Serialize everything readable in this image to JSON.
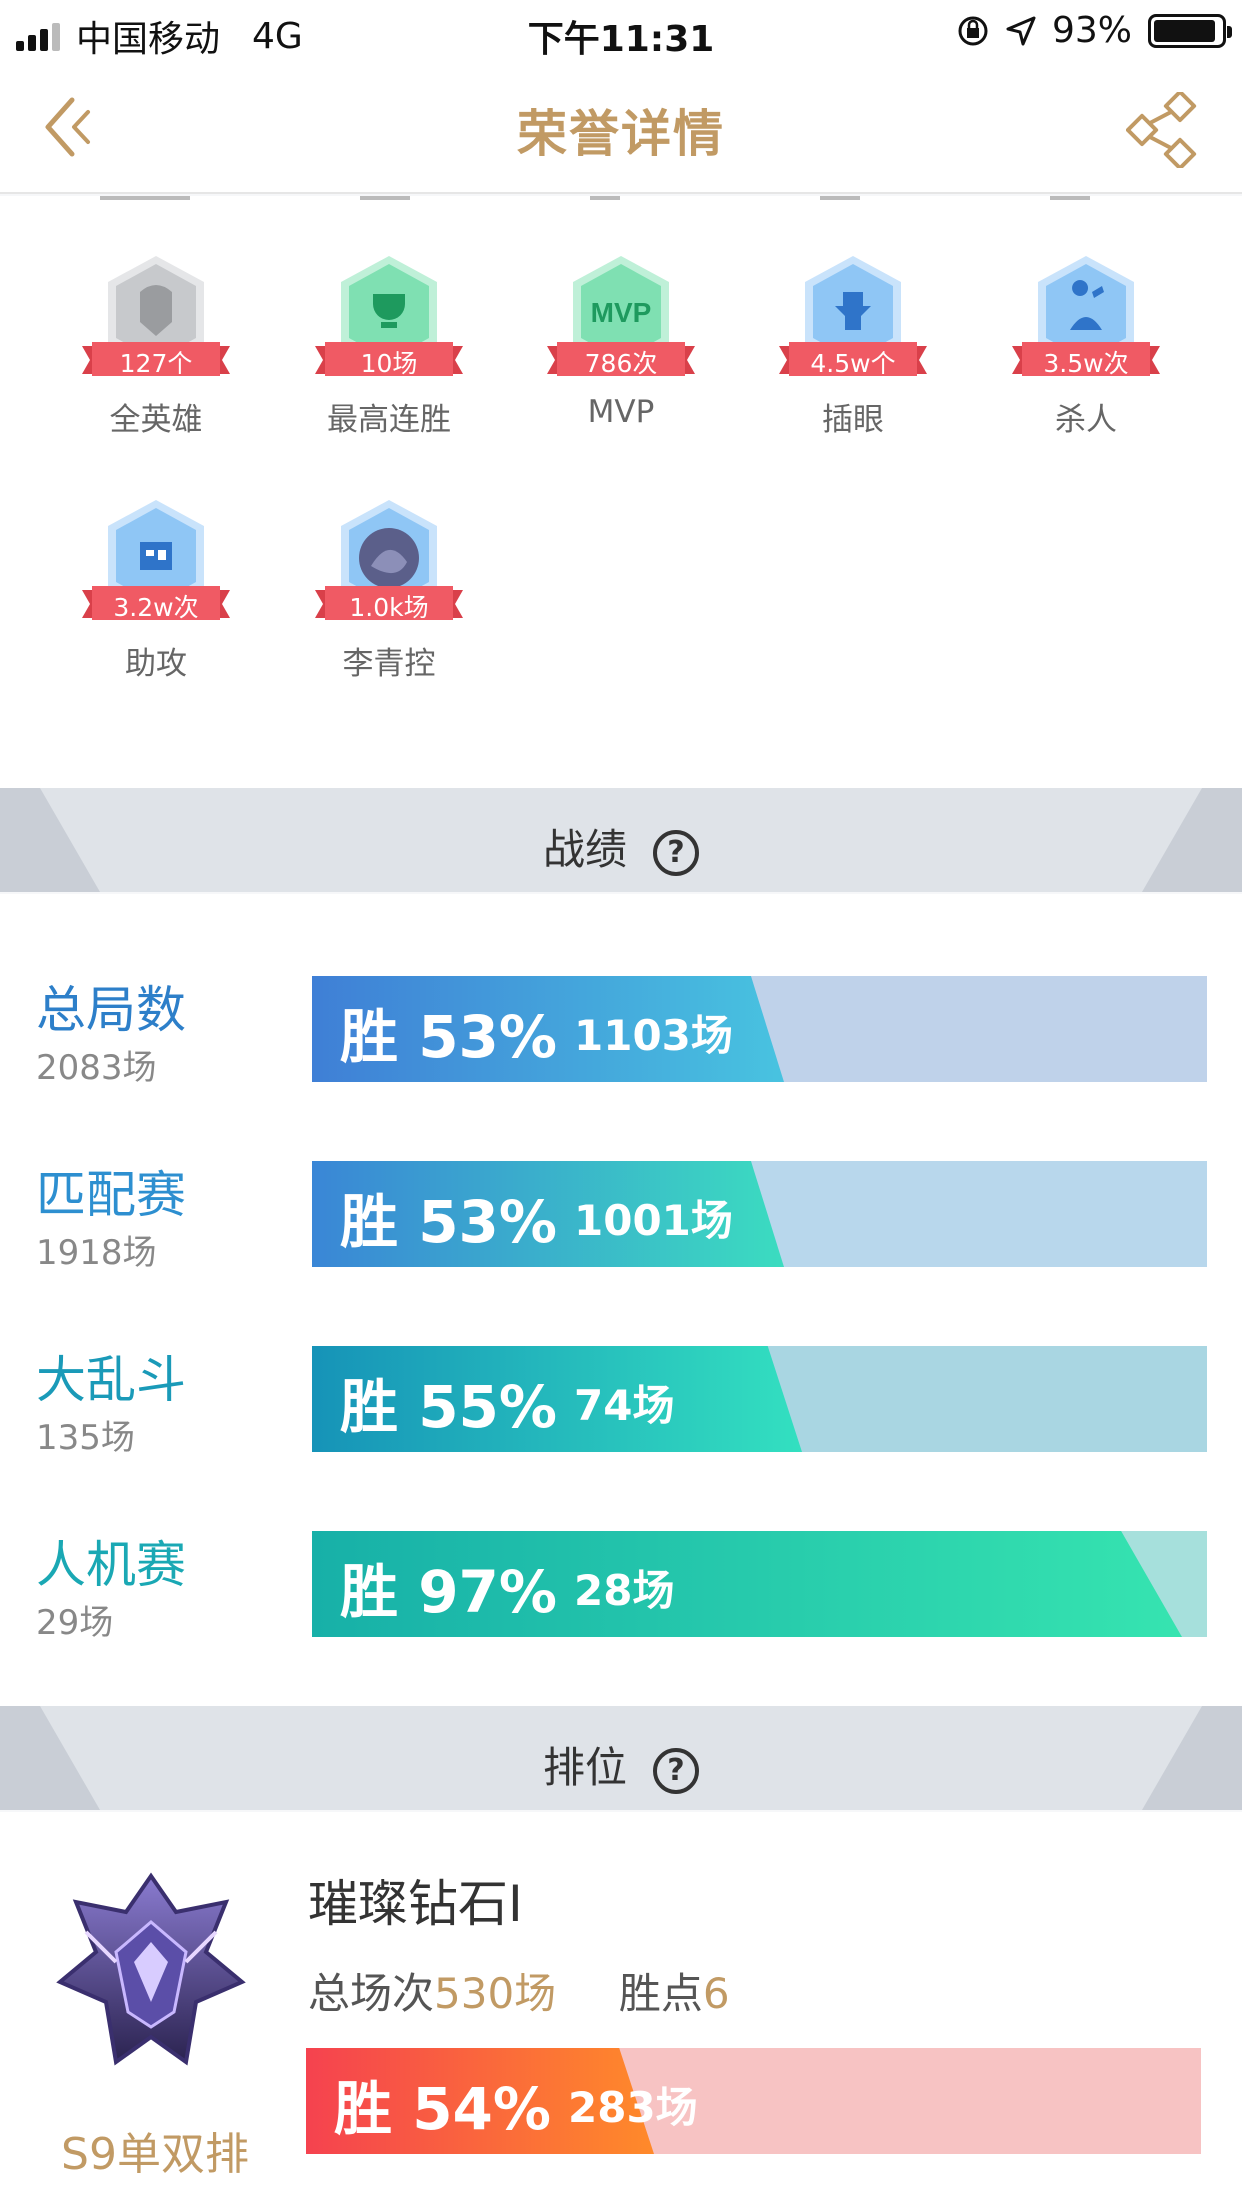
{
  "status_bar": {
    "carrier": "中国移动",
    "network": "4G",
    "time": "下午11:31",
    "battery": "93%",
    "battery_level": 0.93
  },
  "nav": {
    "title": "荣誉详情"
  },
  "honors": [
    {
      "count": "127个",
      "label": "全英雄",
      "color": "gray"
    },
    {
      "count": "10场",
      "label": "最高连胜",
      "color": "green"
    },
    {
      "count": "786次",
      "label": "MVP",
      "color": "green"
    },
    {
      "count": "4.5w个",
      "label": "插眼",
      "color": "blue"
    },
    {
      "count": "3.5w次",
      "label": "杀人",
      "color": "blue"
    },
    {
      "count": "3.2w次",
      "label": "助攻",
      "color": "blue"
    },
    {
      "count": "1.0k场",
      "label": "李青控",
      "color": "blue"
    }
  ],
  "sections": {
    "stats_title": "战绩",
    "ranked_title": "排位",
    "help_glyph": "?"
  },
  "stats": [
    {
      "name": "总局数",
      "total": "2083场",
      "win_label": "胜 53%",
      "games": "1103场",
      "win_rate": 0.53
    },
    {
      "name": "匹配赛",
      "total": "1918场",
      "win_label": "胜 53%",
      "games": "1001场",
      "win_rate": 0.53
    },
    {
      "name": "大乱斗",
      "total": "135场",
      "win_label": "胜 55%",
      "games": "74场",
      "win_rate": 0.55
    },
    {
      "name": "人机赛",
      "total": "29场",
      "win_label": "胜 97%",
      "games": "28场",
      "win_rate": 0.97
    }
  ],
  "ranked": {
    "tier": "璀璨钻石I",
    "total_label": "总场次",
    "total_value": "530场",
    "points_label": "胜点",
    "points_value": "6",
    "win_label": "胜 54%",
    "games": "283场",
    "win_rate": 0.54,
    "season": "S9单双排"
  },
  "colors": {
    "accent": "#c19a64",
    "ribbon": "#f05a64",
    "stat_name": "#2d8fd0"
  }
}
